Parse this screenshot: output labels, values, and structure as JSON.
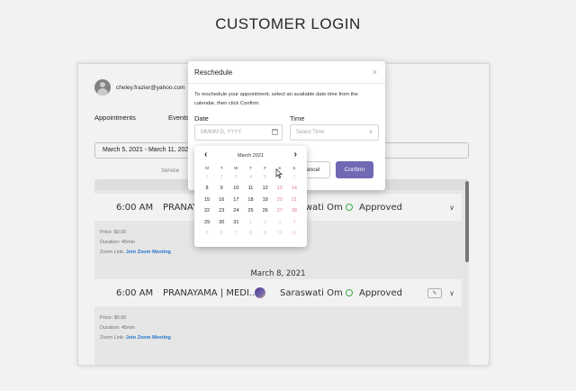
{
  "page": {
    "title": "CUSTOMER LOGIN"
  },
  "account": {
    "email": "cheley.frazier@yahoo.com",
    "caret": "∨"
  },
  "tabs": {
    "appointments": "Appointments",
    "events": "Events"
  },
  "filter": {
    "date_range": "March 5, 2021 - March 11, 2021"
  },
  "columns": {
    "service": "Service"
  },
  "appointments": [
    {
      "time": "6:00 AM",
      "service": "PRANAYAMA | MEDI...",
      "teacher": "Saraswati Om",
      "status": "Approved",
      "price": "Price: $0.00",
      "duration": "Duration: 45min",
      "zoom_label": "Zoom Link:",
      "zoom_link": "Join Zoom Meeting"
    },
    {
      "day": "March 8, 2021",
      "time": "6:00 AM",
      "service": "PRANAYAMA | MEDI...",
      "teacher": "Saraswati Om",
      "status": "Approved",
      "price": "Price: $0.00",
      "duration": "Duration: 45min",
      "zoom_label": "Zoom Link:",
      "zoom_link": "Join Zoom Meeting"
    }
  ],
  "modal": {
    "title": "Reschedule",
    "close": "×",
    "description": "To reschedule your appointment, select an available date time from the calendar, then click Confirm.",
    "date_label": "Date",
    "date_placeholder": "MMMM D, YYYY",
    "time_label": "Time",
    "time_placeholder": "Select Time",
    "cancel": "Cancel",
    "confirm": "Confirm"
  },
  "calendar": {
    "month": "March 2021",
    "prev": "‹",
    "next": "›",
    "weekdays": [
      "M",
      "T",
      "W",
      "T",
      "F",
      "S",
      "S"
    ],
    "weeks": [
      [
        "1",
        "2",
        "3",
        "4",
        "5",
        "6",
        "7"
      ],
      [
        "8",
        "9",
        "10",
        "11",
        "12",
        "13",
        "14"
      ],
      [
        "15",
        "16",
        "17",
        "18",
        "19",
        "20",
        "21"
      ],
      [
        "22",
        "23",
        "24",
        "25",
        "26",
        "27",
        "28"
      ],
      [
        "29",
        "30",
        "31",
        "1",
        "2",
        "3",
        "4"
      ],
      [
        "5",
        "6",
        "7",
        "8",
        "9",
        "10",
        "11"
      ]
    ]
  },
  "colors": {
    "accent": "#7069b3",
    "status": "#3bb44a",
    "link": "#2a7cd6",
    "weekend": "#e07a8c"
  }
}
